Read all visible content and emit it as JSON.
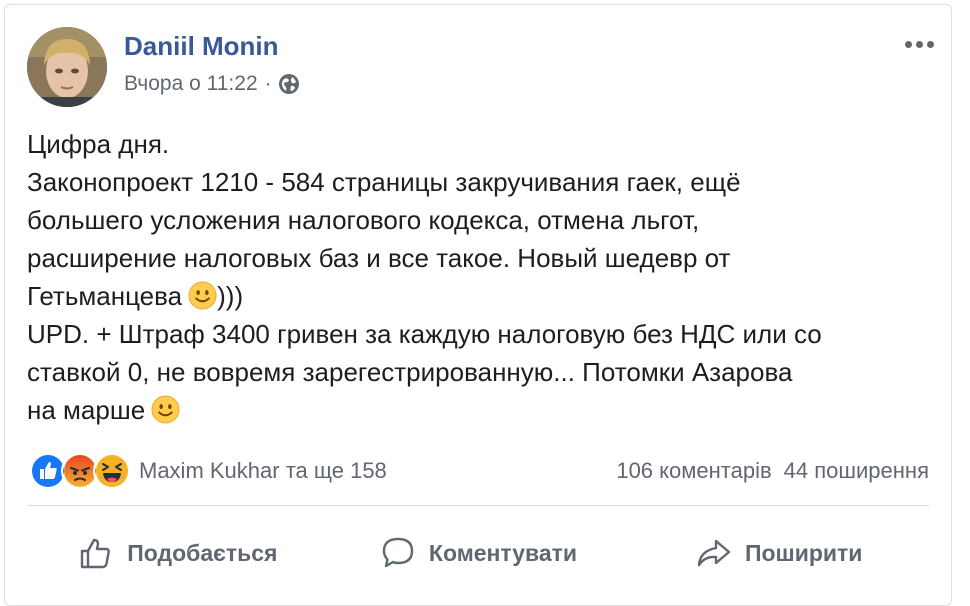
{
  "post": {
    "author": "Daniil Monin",
    "timestamp": "Вчора о 11:22",
    "separator": "·",
    "privacy_icon": "globe-icon",
    "lines": [
      "Цифра дня.",
      "Законопроект 1210 - 584 страницы закручивания гаек, ещё",
      "большего усложения налогового кодекса, отмена льгот,",
      "расширение налоговых баз и все такое. Новый шедевр от",
      "Гетьманцева",
      ")))",
      "UPD. + Штраф 3400 гривен за каждую налоговую без НДС или со",
      "ставкой 0, не вовремя зарегестрированную... Потомки Азарова",
      "на марше"
    ]
  },
  "reactions": {
    "icons": [
      "like-icon",
      "angry-icon",
      "haha-icon"
    ],
    "names": "Maxim Kukhar та ще 158",
    "comments": "106 коментарів",
    "shares": "44 поширення"
  },
  "actions": {
    "like": "Подобається",
    "comment": "Коментувати",
    "share": "Поширити"
  },
  "colors": {
    "author": "#385898",
    "secondary": "#606770",
    "text": "#1c1e21",
    "like": "#1877f2",
    "angry": "#e9710f",
    "haha": "#f7b125"
  }
}
